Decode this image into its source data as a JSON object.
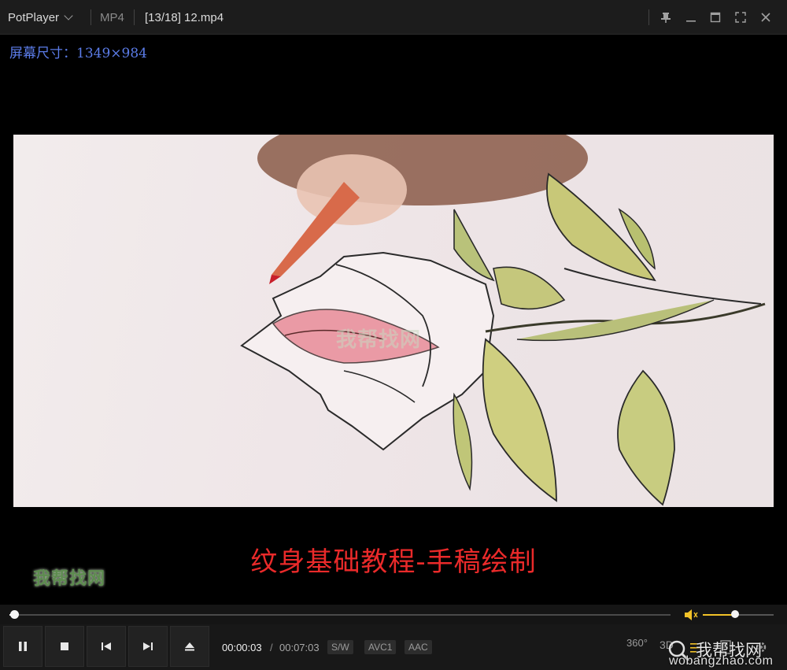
{
  "titlebar": {
    "app_name": "PotPlayer",
    "format": "MP4",
    "file_title": "[13/18] 12.mp4"
  },
  "overlay": {
    "screen_size": "屏幕尺寸：1349×984"
  },
  "video": {
    "subtitle": "纹身基础教程-手稿绘制",
    "watermark_left": "我帮找网",
    "watermark_center": "我帮找网"
  },
  "playback": {
    "progress": 0.007,
    "volume": 0.45,
    "time_current": "00:00:03",
    "time_separator": "/",
    "time_total": "00:07:03",
    "badges": [
      "S/W",
      "AVC1",
      "AAC"
    ]
  },
  "right_controls": {
    "vr_label": "360°",
    "threed_label": "3D"
  },
  "watermark_corner": {
    "text": "我帮找网",
    "url": "wobangzhao.com"
  },
  "colors": {
    "accent_volume": "#f2c228",
    "subtitle": "#ea2a2a",
    "overlay_text": "#5b7ce8"
  }
}
